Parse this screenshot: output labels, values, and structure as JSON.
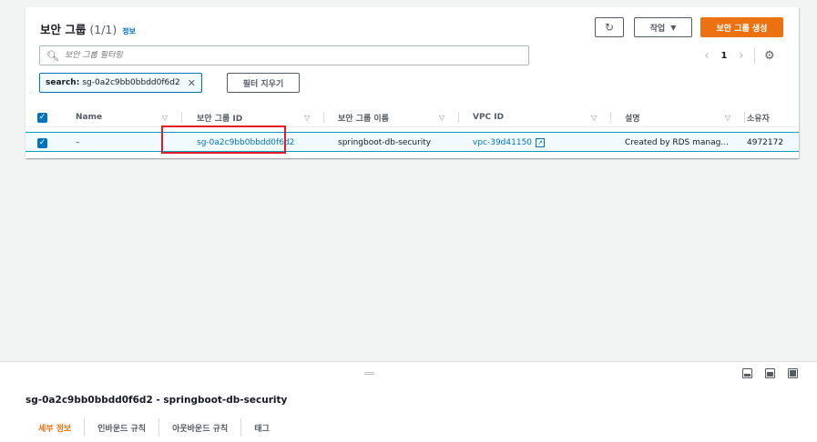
{
  "header": {
    "title": "보안 그룹",
    "count": "(1/1)",
    "info": "정보",
    "refresh_icon": "refresh-icon",
    "actions_label": "작업",
    "create_label": "보안 그룹 생성"
  },
  "filter": {
    "placeholder": "보안 그룹 필터링",
    "token_key": "search:",
    "token_value": "sg-0a2c9bb0bbdd0f6d2",
    "clear_label": "필터 지우기"
  },
  "pager": {
    "page": "1"
  },
  "table": {
    "columns": [
      "Name",
      "보안 그룹 ID",
      "보안 그룹 이름",
      "VPC ID",
      "설명",
      "소유자"
    ],
    "row": {
      "name": "–",
      "sg_id": "sg-0a2c9bb0bbdd0f6d2",
      "sg_name": "springboot-db-security",
      "vpc_id": "vpc-39d41150",
      "description": "Created by RDS manag...",
      "owner": "4972172"
    }
  },
  "detail": {
    "title": "sg-0a2c9bb0bbdd0f6d2 - springboot-db-security",
    "tabs": [
      "세부 정보",
      "인바운드 규칙",
      "아웃바운드 규칙",
      "태그"
    ]
  },
  "colors": {
    "accent": "#ec7211",
    "link": "#0073bb",
    "highlight": "#e51c23"
  }
}
